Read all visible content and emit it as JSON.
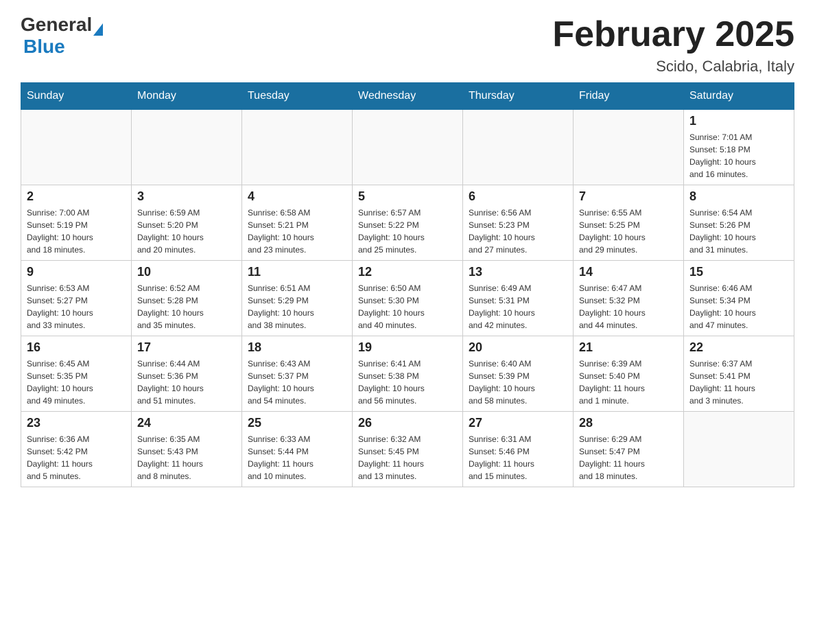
{
  "header": {
    "logo_general": "General",
    "logo_blue": "Blue",
    "title": "February 2025",
    "subtitle": "Scido, Calabria, Italy"
  },
  "days_of_week": [
    "Sunday",
    "Monday",
    "Tuesday",
    "Wednesday",
    "Thursday",
    "Friday",
    "Saturday"
  ],
  "weeks": [
    [
      {
        "day": "",
        "info": ""
      },
      {
        "day": "",
        "info": ""
      },
      {
        "day": "",
        "info": ""
      },
      {
        "day": "",
        "info": ""
      },
      {
        "day": "",
        "info": ""
      },
      {
        "day": "",
        "info": ""
      },
      {
        "day": "1",
        "info": "Sunrise: 7:01 AM\nSunset: 5:18 PM\nDaylight: 10 hours\nand 16 minutes."
      }
    ],
    [
      {
        "day": "2",
        "info": "Sunrise: 7:00 AM\nSunset: 5:19 PM\nDaylight: 10 hours\nand 18 minutes."
      },
      {
        "day": "3",
        "info": "Sunrise: 6:59 AM\nSunset: 5:20 PM\nDaylight: 10 hours\nand 20 minutes."
      },
      {
        "day": "4",
        "info": "Sunrise: 6:58 AM\nSunset: 5:21 PM\nDaylight: 10 hours\nand 23 minutes."
      },
      {
        "day": "5",
        "info": "Sunrise: 6:57 AM\nSunset: 5:22 PM\nDaylight: 10 hours\nand 25 minutes."
      },
      {
        "day": "6",
        "info": "Sunrise: 6:56 AM\nSunset: 5:23 PM\nDaylight: 10 hours\nand 27 minutes."
      },
      {
        "day": "7",
        "info": "Sunrise: 6:55 AM\nSunset: 5:25 PM\nDaylight: 10 hours\nand 29 minutes."
      },
      {
        "day": "8",
        "info": "Sunrise: 6:54 AM\nSunset: 5:26 PM\nDaylight: 10 hours\nand 31 minutes."
      }
    ],
    [
      {
        "day": "9",
        "info": "Sunrise: 6:53 AM\nSunset: 5:27 PM\nDaylight: 10 hours\nand 33 minutes."
      },
      {
        "day": "10",
        "info": "Sunrise: 6:52 AM\nSunset: 5:28 PM\nDaylight: 10 hours\nand 35 minutes."
      },
      {
        "day": "11",
        "info": "Sunrise: 6:51 AM\nSunset: 5:29 PM\nDaylight: 10 hours\nand 38 minutes."
      },
      {
        "day": "12",
        "info": "Sunrise: 6:50 AM\nSunset: 5:30 PM\nDaylight: 10 hours\nand 40 minutes."
      },
      {
        "day": "13",
        "info": "Sunrise: 6:49 AM\nSunset: 5:31 PM\nDaylight: 10 hours\nand 42 minutes."
      },
      {
        "day": "14",
        "info": "Sunrise: 6:47 AM\nSunset: 5:32 PM\nDaylight: 10 hours\nand 44 minutes."
      },
      {
        "day": "15",
        "info": "Sunrise: 6:46 AM\nSunset: 5:34 PM\nDaylight: 10 hours\nand 47 minutes."
      }
    ],
    [
      {
        "day": "16",
        "info": "Sunrise: 6:45 AM\nSunset: 5:35 PM\nDaylight: 10 hours\nand 49 minutes."
      },
      {
        "day": "17",
        "info": "Sunrise: 6:44 AM\nSunset: 5:36 PM\nDaylight: 10 hours\nand 51 minutes."
      },
      {
        "day": "18",
        "info": "Sunrise: 6:43 AM\nSunset: 5:37 PM\nDaylight: 10 hours\nand 54 minutes."
      },
      {
        "day": "19",
        "info": "Sunrise: 6:41 AM\nSunset: 5:38 PM\nDaylight: 10 hours\nand 56 minutes."
      },
      {
        "day": "20",
        "info": "Sunrise: 6:40 AM\nSunset: 5:39 PM\nDaylight: 10 hours\nand 58 minutes."
      },
      {
        "day": "21",
        "info": "Sunrise: 6:39 AM\nSunset: 5:40 PM\nDaylight: 11 hours\nand 1 minute."
      },
      {
        "day": "22",
        "info": "Sunrise: 6:37 AM\nSunset: 5:41 PM\nDaylight: 11 hours\nand 3 minutes."
      }
    ],
    [
      {
        "day": "23",
        "info": "Sunrise: 6:36 AM\nSunset: 5:42 PM\nDaylight: 11 hours\nand 5 minutes."
      },
      {
        "day": "24",
        "info": "Sunrise: 6:35 AM\nSunset: 5:43 PM\nDaylight: 11 hours\nand 8 minutes."
      },
      {
        "day": "25",
        "info": "Sunrise: 6:33 AM\nSunset: 5:44 PM\nDaylight: 11 hours\nand 10 minutes."
      },
      {
        "day": "26",
        "info": "Sunrise: 6:32 AM\nSunset: 5:45 PM\nDaylight: 11 hours\nand 13 minutes."
      },
      {
        "day": "27",
        "info": "Sunrise: 6:31 AM\nSunset: 5:46 PM\nDaylight: 11 hours\nand 15 minutes."
      },
      {
        "day": "28",
        "info": "Sunrise: 6:29 AM\nSunset: 5:47 PM\nDaylight: 11 hours\nand 18 minutes."
      },
      {
        "day": "",
        "info": ""
      }
    ]
  ]
}
